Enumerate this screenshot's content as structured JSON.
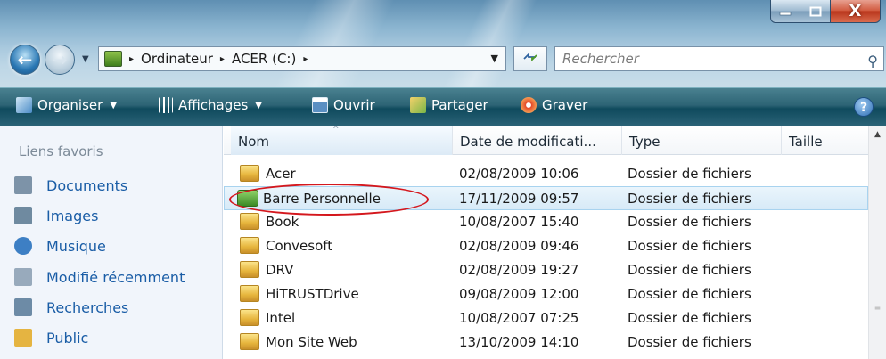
{
  "window": {
    "minimize_icon": "minimize-icon",
    "maximize_icon": "maximize-icon",
    "close_glyph": "X"
  },
  "navigation": {
    "back_glyph": "←",
    "forward_glyph": "→"
  },
  "address_bar": {
    "crumbs": [
      "Ordinateur",
      "ACER (C:)"
    ],
    "separator": "▸"
  },
  "search": {
    "placeholder": "Rechercher",
    "icon": "search-icon"
  },
  "toolbar": {
    "organise_label": "Organiser",
    "views_label": "Affichages",
    "open_label": "Ouvrir",
    "share_label": "Partager",
    "burn_label": "Graver",
    "help_glyph": "?"
  },
  "sidebar": {
    "title": "Liens favoris",
    "items": [
      {
        "label": "Documents",
        "icon": "documents-icon",
        "color": "#7d93a8"
      },
      {
        "label": "Images",
        "icon": "images-icon",
        "color": "#6f8aa0"
      },
      {
        "label": "Musique",
        "icon": "music-icon",
        "color": "#3d7fc4"
      },
      {
        "label": "Modifié récemment",
        "icon": "recent-icon",
        "color": "#98aabc"
      },
      {
        "label": "Recherches",
        "icon": "searches-icon",
        "color": "#6d8ba6"
      },
      {
        "label": "Public",
        "icon": "public-folder-icon",
        "color": "#e5b441"
      }
    ]
  },
  "file_list": {
    "columns": [
      "Nom",
      "Date de modificati...",
      "Type",
      "Taille"
    ],
    "rows": [
      {
        "name": "Acer",
        "date": "02/08/2009 10:06",
        "type": "Dossier de fichiers",
        "size": ""
      },
      {
        "name": "Barre Personnelle",
        "date": "17/11/2009 09:57",
        "type": "Dossier de fichiers",
        "size": "",
        "selected": true
      },
      {
        "name": "Book",
        "date": "10/08/2007 15:40",
        "type": "Dossier de fichiers",
        "size": ""
      },
      {
        "name": "Convesoft",
        "date": "02/08/2009 09:46",
        "type": "Dossier de fichiers",
        "size": ""
      },
      {
        "name": "DRV",
        "date": "02/08/2009 19:27",
        "type": "Dossier de fichiers",
        "size": ""
      },
      {
        "name": "HiTRUSTDrive",
        "date": "09/08/2009 12:00",
        "type": "Dossier de fichiers",
        "size": ""
      },
      {
        "name": "Intel",
        "date": "10/08/2007 07:25",
        "type": "Dossier de fichiers",
        "size": ""
      },
      {
        "name": "Mon Site Web",
        "date": "13/10/2009 14:10",
        "type": "Dossier de fichiers",
        "size": ""
      }
    ]
  },
  "colors": {
    "accent_link": "#1a5da6",
    "highlight_ring": "#d4171d",
    "command_bar": "#2d6475"
  }
}
